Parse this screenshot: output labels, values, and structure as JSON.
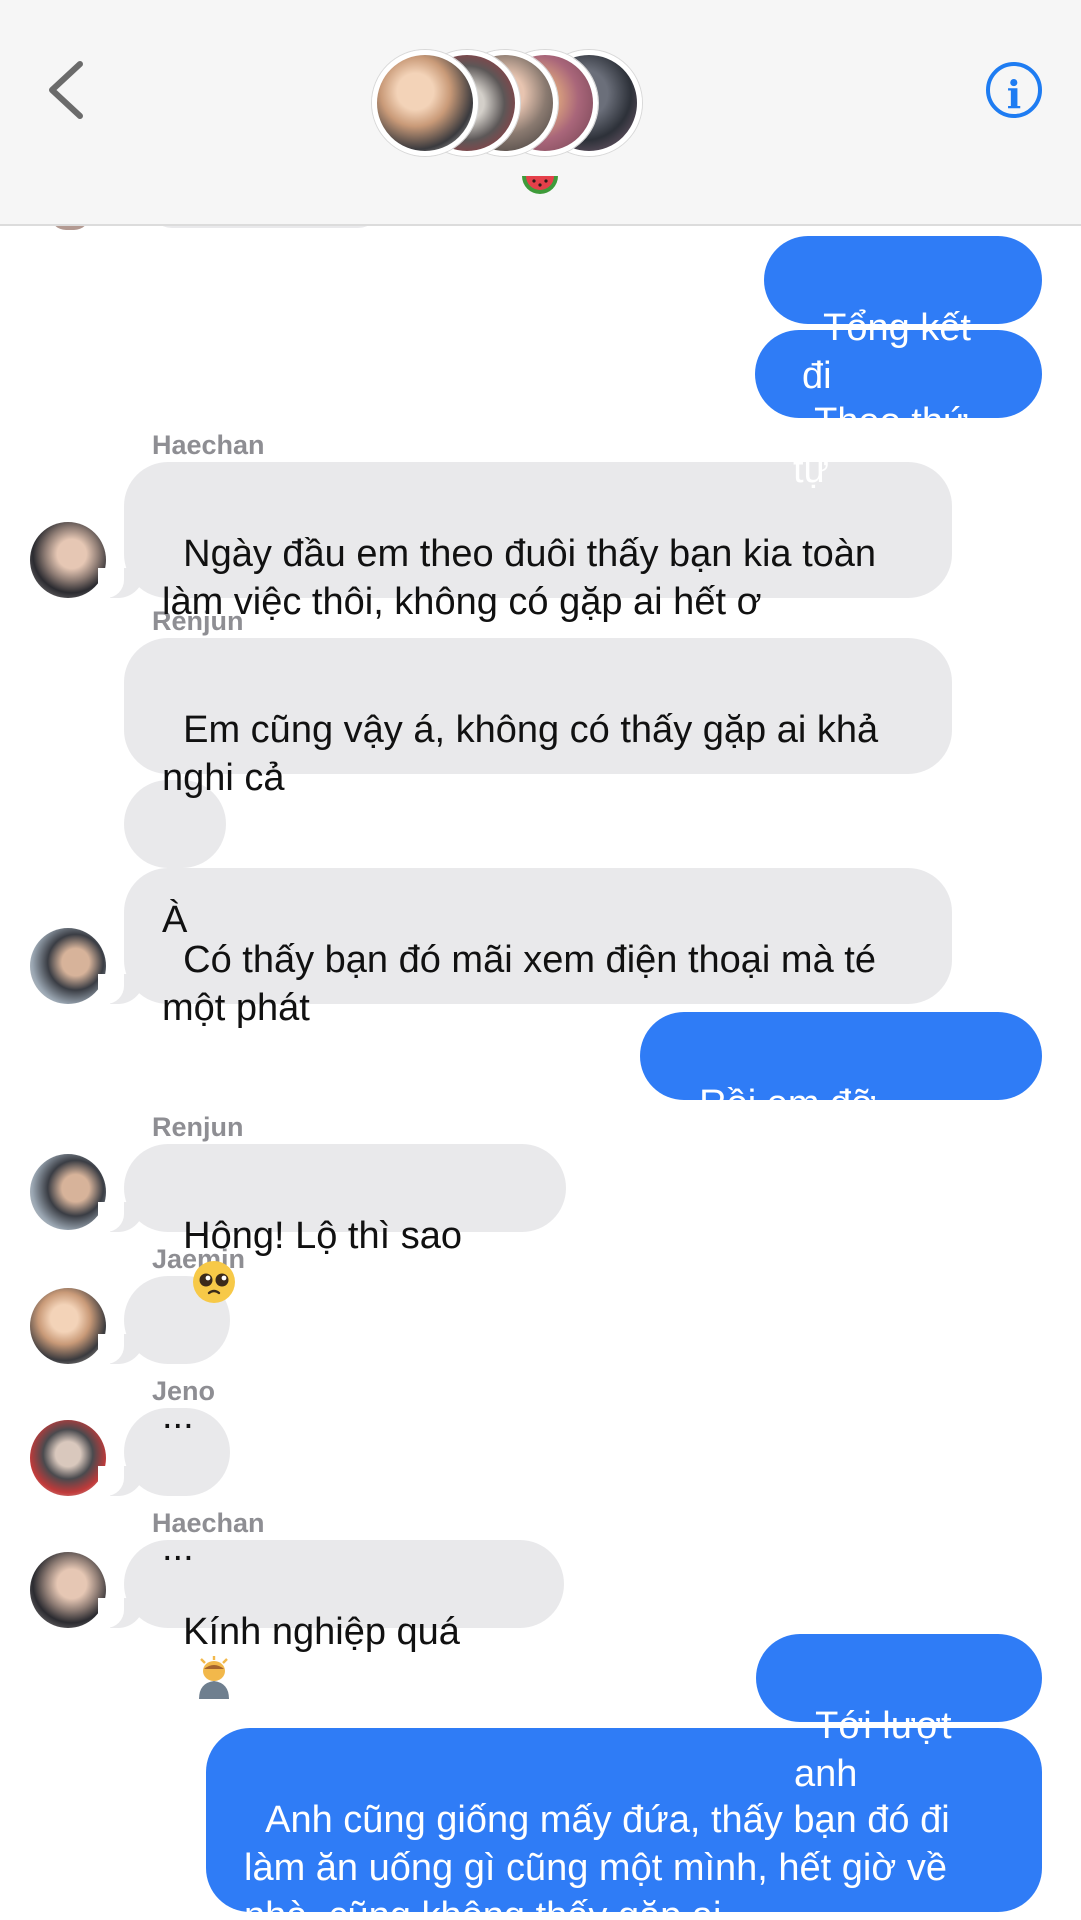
{
  "header": {
    "back_icon": "chevron-left-icon",
    "info_icon": "info-icon",
    "info_glyph": "i",
    "group_emoji": "🍉",
    "group_avatar_count": 5
  },
  "colors": {
    "outgoing_bubble": "#2f7cf6",
    "incoming_bubble": "#e9e9eb",
    "sender_name": "#8e8e93",
    "accent": "#1e7cf2"
  },
  "messages": [
    {
      "dir": "out",
      "text": "Tổng kết đi"
    },
    {
      "dir": "out",
      "text": "Theo thứ tự"
    },
    {
      "dir": "in",
      "sender": "Haechan",
      "text": "Ngày đầu em theo đuôi thấy bạn kia toàn\nlàm việc thôi, không có gặp ai hết ơ"
    },
    {
      "dir": "in",
      "sender": "Renjun",
      "text": "Em cũng vậy á, không có thấy gặp ai khả\nnghi cả"
    },
    {
      "dir": "in",
      "text": "À"
    },
    {
      "dir": "in",
      "text": "Có thấy bạn đó mãi xem điện thoại mà té\nmột phát"
    },
    {
      "dir": "out",
      "text": "Rồi em đỡ không?"
    },
    {
      "dir": "in",
      "sender": "Renjun",
      "text": "Hông! Lộ thì sao",
      "emoji": "pleading-face-icon"
    },
    {
      "dir": "in",
      "sender": "Jaemin",
      "text": "..."
    },
    {
      "dir": "in",
      "sender": "Jeno",
      "text": "..."
    },
    {
      "dir": "in",
      "sender": "Haechan",
      "text": "Kính nghiệp quá",
      "emoji": "bowing-person-icon"
    },
    {
      "dir": "out",
      "text": "Tới lượt anh"
    },
    {
      "dir": "out",
      "text": "Anh cũng giống mấy đứa, thấy bạn đó đi\nlàm ăn uống gì cũng một mình, hết giờ về\nnhà, cũng không thấy gặp ai"
    }
  ]
}
